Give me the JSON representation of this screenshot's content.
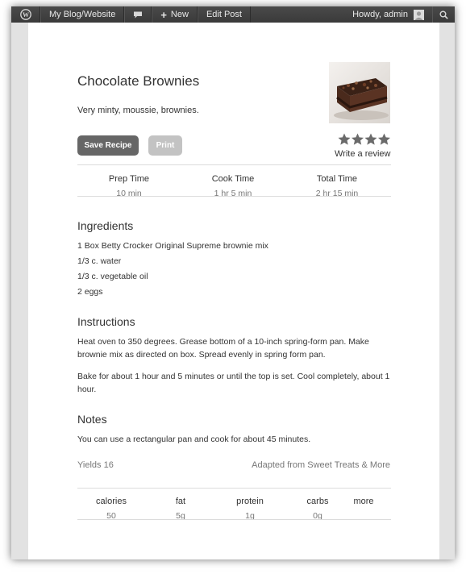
{
  "adminbar": {
    "site": "My Blog/Website",
    "new": "New",
    "edit_post": "Edit Post",
    "howdy": "Howdy, admin"
  },
  "recipe": {
    "title": "Chocolate Brownies",
    "summary": "Very minty, moussie, brownies.",
    "save_label": "Save Recipe",
    "print_label": "Print",
    "rating": 4,
    "rating_max": 4,
    "review_label": "Write a review",
    "times": [
      {
        "label": "Prep Time",
        "value": "10 min"
      },
      {
        "label": "Cook Time",
        "value": "1 hr 5 min"
      },
      {
        "label": "Total Time",
        "value": "2 hr 15 min"
      }
    ],
    "ingredients_heading": "Ingredients",
    "ingredients": [
      "1 Box Betty Crocker Original Supreme brownie mix",
      "1/3 c. water",
      "1/3 c. vegetable oil",
      "2 eggs"
    ],
    "instructions_heading": "Instructions",
    "instructions": [
      "Heat oven to 350 degrees. Grease bottom of a 10-inch spring-form pan. Make brownie mix as directed on box. Spread evenly in spring form pan.",
      "Bake for about 1 hour and 5 minutes or until the top is set. Cool completely, about 1 hour."
    ],
    "notes_heading": "Notes",
    "notes": "You can use a rectangular pan and cook for about 45 minutes.",
    "yields": "Yields 16",
    "adapted_prefix": "Adapted from",
    "adapted_source": "Sweet Treats & More",
    "nutrition": [
      {
        "label": "calories",
        "value": "50"
      },
      {
        "label": "fat",
        "value": "5g"
      },
      {
        "label": "protein",
        "value": "1g"
      },
      {
        "label": "carbs",
        "value": "0g"
      },
      {
        "label": "more",
        "value": ""
      }
    ]
  },
  "colors": {
    "adminbar_bg": "#3f3f3f",
    "button_primary": "#666666",
    "button_disabled": "#c3c3c3",
    "star": "#6b6b6b",
    "muted_text": "#777777"
  },
  "icons": [
    "wordpress-logo-icon",
    "comment-bubble-icon",
    "plus-icon",
    "avatar-icon",
    "search-icon",
    "star-icon"
  ]
}
